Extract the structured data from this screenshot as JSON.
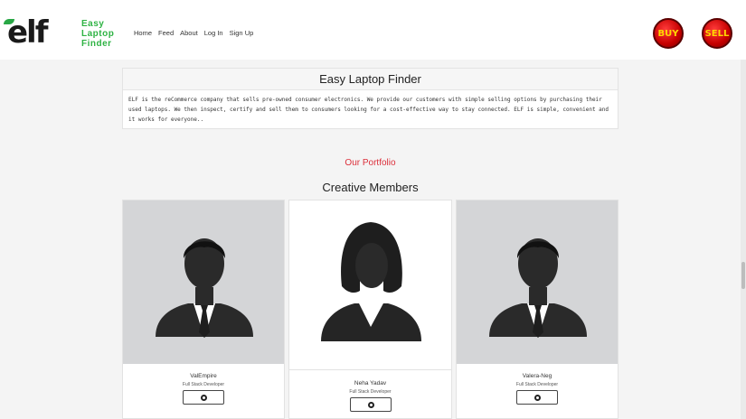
{
  "brand": {
    "logo_word": "elf",
    "logo_lines": [
      "Easy",
      "Laptop",
      "Finder"
    ]
  },
  "nav": {
    "items": [
      "Home",
      "Feed",
      "About",
      "Log In",
      "Sign Up"
    ]
  },
  "actions": {
    "buy_label": "BUY",
    "sell_label": "SELL"
  },
  "about": {
    "title": "Easy Laptop Finder",
    "body": "ELF is the reCommerce company that sells pre-owned consumer electronics. We provide our customers with simple selling options by purchasing their used laptops. We then inspect, certify and sell them to consumers looking for a cost-effective way to stay connected. ELF is simple, convenient and it works for everyone.."
  },
  "portfolio": {
    "heading": "Our Portfolio",
    "title": "Creative Members",
    "members": [
      {
        "name": "ValEmpire",
        "role": "Full Stack Developer",
        "gender": "male",
        "icon": "github-icon"
      },
      {
        "name": "Neha Yadav",
        "role": "Full Stack Developer",
        "gender": "female",
        "icon": "github-icon"
      },
      {
        "name": "Valera-Neg",
        "role": "Full Stack Developer",
        "gender": "male",
        "icon": "github-icon"
      }
    ]
  },
  "colors": {
    "accent_red": "#dc2f3a",
    "logo_green": "#2fb344",
    "button_red": "#c60000",
    "button_text": "#ffd700"
  }
}
